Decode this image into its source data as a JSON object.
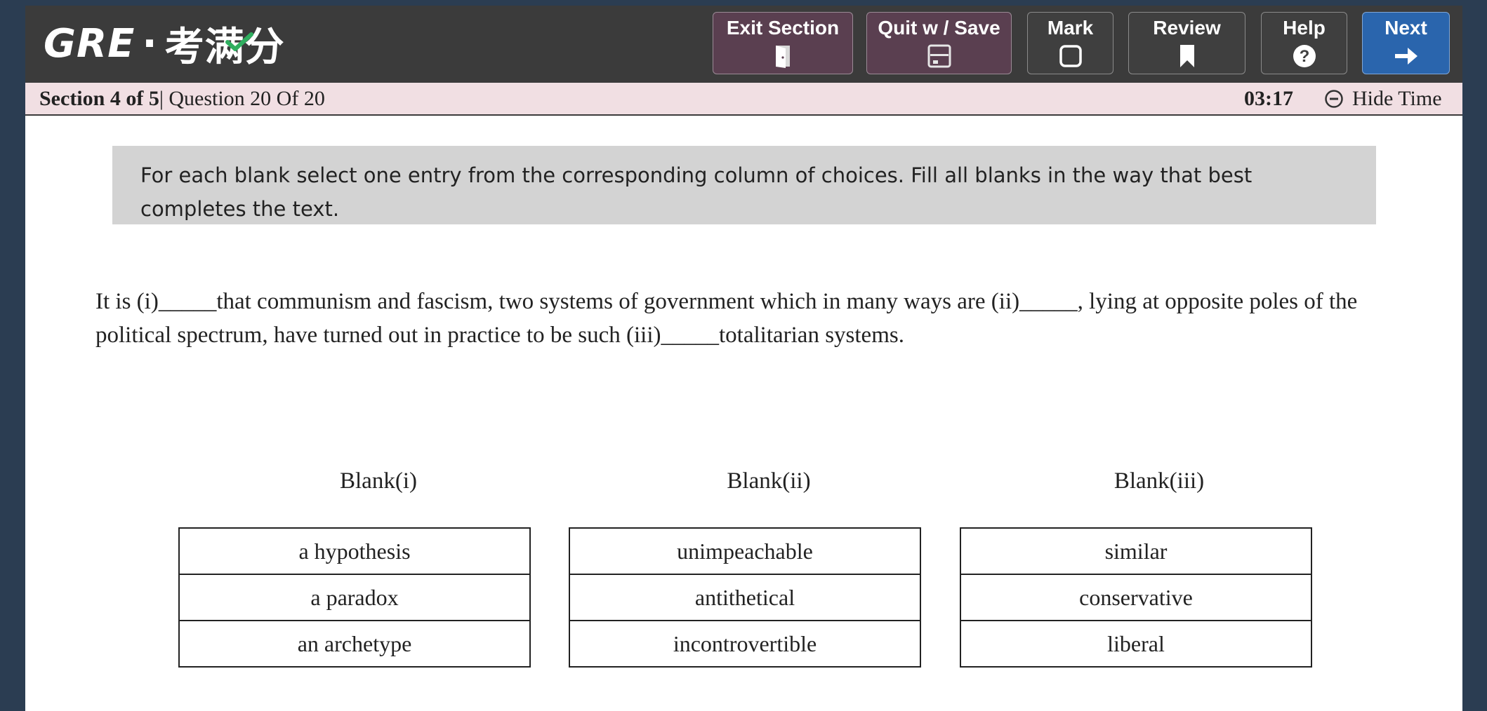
{
  "header": {
    "logo_latin": "GRE",
    "logo_dot": "·",
    "logo_cn": "考满分",
    "buttons": {
      "exit": "Exit Section",
      "quit": "Quit w / Save",
      "mark": "Mark",
      "review": "Review",
      "help": "Help",
      "next": "Next"
    }
  },
  "section_bar": {
    "section": "Section 4 of 5",
    "separator": "|",
    "question": " Question 20 Of 20",
    "timer": "03:17",
    "hide_time": "Hide Time"
  },
  "directions": "For each blank select one entry from the corresponding column of choices. Fill all blanks in the way that best completes the text.",
  "question": {
    "part1": "It is (i)",
    "blank": "_____",
    "part2": "that communism and fascism, two systems of government which in many ways are (ii)",
    "part3": ", lying at opposite poles of the political spectrum, have turned out in practice to be such (iii)",
    "part4": "totalitarian systems."
  },
  "blanks": [
    {
      "label": "Blank(i)",
      "choices": [
        "a hypothesis",
        "a paradox",
        "an archetype"
      ]
    },
    {
      "label": "Blank(ii)",
      "choices": [
        "unimpeachable",
        "antithetical",
        "incontrovertible"
      ]
    },
    {
      "label": "Blank(iii)",
      "choices": [
        "similar",
        "conservative",
        "liberal"
      ]
    }
  ],
  "colors": {
    "topbar": "#3b3b3b",
    "button_purple": "#5a3f50",
    "next_blue": "#2a65ad",
    "section_bar": "#f1dfe3",
    "directions_bg": "#d3d3d3",
    "logo_check": "#2fae5f",
    "page_border": "#2b3d52"
  }
}
